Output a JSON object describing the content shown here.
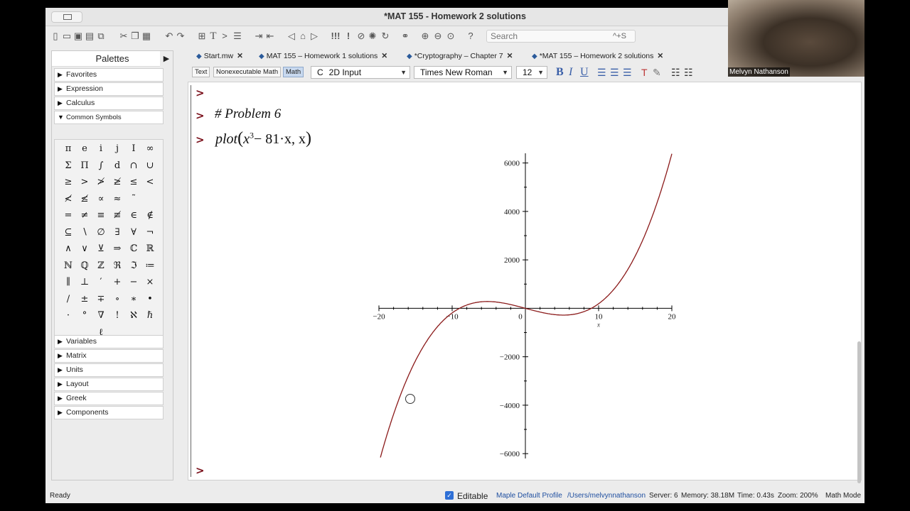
{
  "window": {
    "title": "*MAT 155 - Homework 2 solutions"
  },
  "toolbar": {
    "search_placeholder": "Search",
    "search_shortcut": "^+S"
  },
  "palettes": {
    "header": "Palettes",
    "top_items": [
      "Favorites",
      "Expression",
      "Calculus",
      "Common Symbols"
    ],
    "bottom_items": [
      "Variables",
      "Matrix",
      "Units",
      "Layout",
      "Greek",
      "Components"
    ],
    "symbols": [
      [
        "π",
        "e",
        "i",
        "j",
        "I",
        "∞"
      ],
      [
        "Σ",
        "Π",
        "∫",
        "d",
        "∩",
        "∪"
      ],
      [
        "≥",
        ">",
        "≯",
        "≱",
        "≤",
        "<"
      ],
      [
        "≮",
        "≰",
        "∝",
        "≈",
        "˜",
        ""
      ],
      [
        "=",
        "≠",
        "≡",
        "≢",
        "∈",
        "∉"
      ],
      [
        "⊆",
        "∖",
        "∅",
        "∃",
        "∀",
        "¬"
      ],
      [
        "∧",
        "∨",
        "⊻",
        "⇒",
        "ℂ",
        "ℝ"
      ],
      [
        "ℕ",
        "ℚ",
        "ℤ",
        "ℜ",
        "ℑ",
        "≔"
      ],
      [
        "∥",
        "⊥",
        "′",
        "+",
        "−",
        "×"
      ],
      [
        "/",
        "±",
        "∓",
        "∘",
        "∗",
        "•"
      ],
      [
        "·",
        "°",
        "∇",
        "!",
        "ℵ",
        "ℏ"
      ],
      [
        "",
        "",
        "ℓ",
        "",
        "",
        ""
      ]
    ]
  },
  "tabs": [
    {
      "label": "Start.mw"
    },
    {
      "label": "MAT 155 – Homework 1 solutions"
    },
    {
      "label": "*Cryptography – Chapter 7"
    },
    {
      "label": "*MAT 155 – Homework 2 solutions"
    }
  ],
  "format_bar": {
    "text_mode": "Text",
    "nonexec_mode": "Nonexecutable Math",
    "math_mode": "Math",
    "input_mode": "2D Input",
    "input_mode_prefix": "C",
    "font": "Times New Roman",
    "font_size": "12",
    "bold": "B",
    "italic": "I",
    "underline": "U"
  },
  "worksheet": {
    "prompt_symbol": ">",
    "comment": "# Problem 6",
    "command_plot": "plot",
    "command_x": "x",
    "command_exp": "3",
    "command_rest": "− 81·x, x",
    "paren_open": "(",
    "paren_close": ")"
  },
  "chart_data": {
    "type": "line",
    "function": "x^3 - 81*x",
    "x_range": [
      -20,
      20
    ],
    "ylim": [
      -6200,
      6400
    ],
    "x_ticks": [
      -20,
      -10,
      0,
      10,
      20
    ],
    "y_ticks": [
      -6000,
      -4000,
      -2000,
      2000,
      4000,
      6000
    ],
    "x_tick_labels": [
      "−20",
      "−10",
      "0",
      "10",
      "20"
    ],
    "y_tick_labels": [
      "−6000",
      "−4000",
      "−2000",
      "2000",
      "4000",
      "6000"
    ],
    "xlabel": "x",
    "ylabel": "",
    "line_color": "#8b1a1a",
    "grid": false
  },
  "status_bar": {
    "state": "Ready",
    "editable": "Editable",
    "profile": "Maple Default Profile",
    "path": "/Users/melvynnathanson",
    "server": "Server: 6",
    "memory": "Memory: 38.18M",
    "time": "Time: 0.43s",
    "zoom": "Zoom: 200%",
    "mode": "Math Mode"
  },
  "webcam": {
    "name": "Melvyn Nathanson"
  }
}
